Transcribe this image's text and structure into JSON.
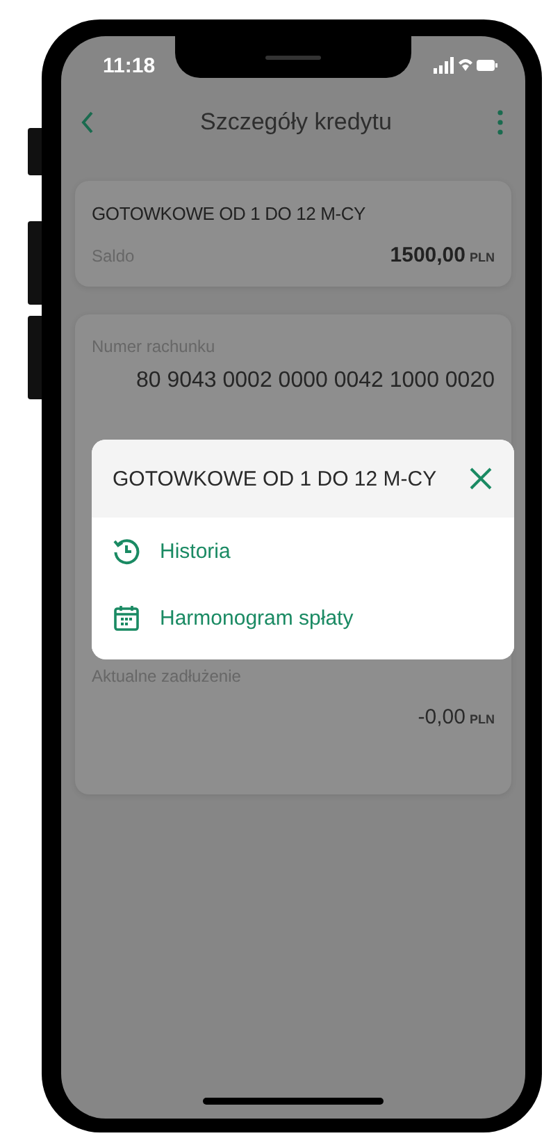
{
  "status_bar": {
    "time": "11:18"
  },
  "header": {
    "title": "Szczegóły kredytu"
  },
  "summary_card": {
    "name": "GOTOWKOWE OD 1 DO 12 M-CY",
    "balance_label": "Saldo",
    "balance_amount": "1500,00",
    "balance_currency": "PLN"
  },
  "details_card": {
    "account_label": "Numer rachunku",
    "account_number": "80 9043 0002 0000 0042 1000 0020",
    "debt_label": "Aktualne zadłużenie",
    "debt_amount": "-0,00",
    "debt_currency": "PLN"
  },
  "dialog": {
    "title": "GOTOWKOWE OD 1 DO 12 M-CY",
    "items": [
      {
        "kind": "history",
        "label": "Historia"
      },
      {
        "kind": "calendar",
        "label": "Harmonogram spłaty"
      }
    ]
  }
}
